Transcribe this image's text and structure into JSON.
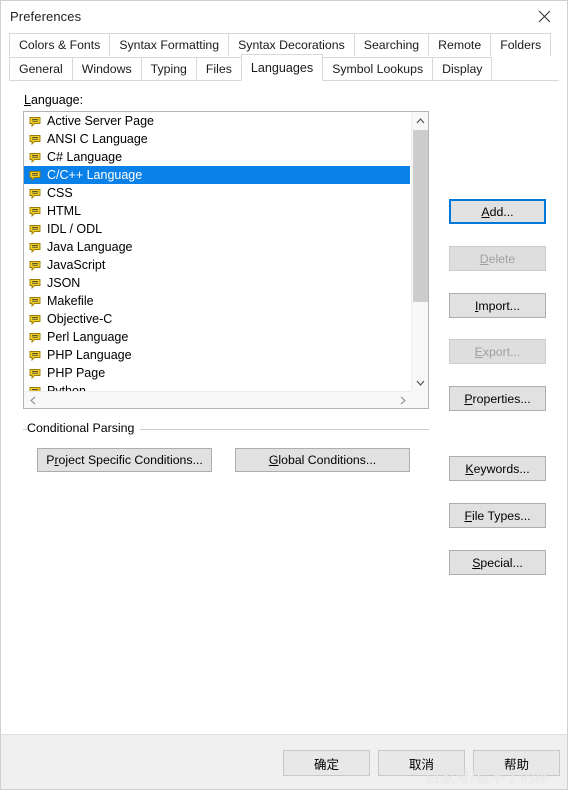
{
  "window": {
    "title": "Preferences",
    "close_icon": "close-icon"
  },
  "tabs": {
    "row1": [
      {
        "label": "Colors & Fonts",
        "selected": false
      },
      {
        "label": "Syntax Formatting",
        "selected": false
      },
      {
        "label": "Syntax Decorations",
        "selected": false
      },
      {
        "label": "Searching",
        "selected": false
      },
      {
        "label": "Remote",
        "selected": false
      },
      {
        "label": "Folders",
        "selected": false
      }
    ],
    "row2": [
      {
        "label": "General",
        "selected": false
      },
      {
        "label": "Windows",
        "selected": false
      },
      {
        "label": "Typing",
        "selected": false
      },
      {
        "label": "Files",
        "selected": false
      },
      {
        "label": "Languages",
        "selected": true
      },
      {
        "label": "Symbol Lookups",
        "selected": false
      },
      {
        "label": "Display",
        "selected": false
      }
    ]
  },
  "language_section": {
    "label_prefix": "L",
    "label_rest": "anguage:",
    "items": [
      {
        "label": "Active Server Page",
        "selected": false
      },
      {
        "label": "ANSI C Language",
        "selected": false
      },
      {
        "label": "C# Language",
        "selected": false
      },
      {
        "label": "C/C++ Language",
        "selected": true
      },
      {
        "label": "CSS",
        "selected": false
      },
      {
        "label": "HTML",
        "selected": false
      },
      {
        "label": "IDL / ODL",
        "selected": false
      },
      {
        "label": "Java Language",
        "selected": false
      },
      {
        "label": "JavaScript",
        "selected": false
      },
      {
        "label": "JSON",
        "selected": false
      },
      {
        "label": "Makefile",
        "selected": false
      },
      {
        "label": "Objective-C",
        "selected": false
      },
      {
        "label": "Perl Language",
        "selected": false
      },
      {
        "label": "PHP Language",
        "selected": false
      },
      {
        "label": "PHP Page",
        "selected": false
      },
      {
        "label": "Python",
        "selected": false
      }
    ],
    "item_icon": "language-file-icon",
    "scrollbar": {
      "up_icon": "chevron-up-icon",
      "down_icon": "chevron-down-icon",
      "left_icon": "chevron-left-icon",
      "right_icon": "chevron-right-icon"
    }
  },
  "side_buttons": [
    {
      "accel": "A",
      "rest": "dd...",
      "disabled": false,
      "default": true
    },
    {
      "accel": "D",
      "rest": "elete",
      "disabled": true,
      "default": false
    },
    {
      "accel": "I",
      "rest": "mport...",
      "disabled": false,
      "default": false
    },
    {
      "accel": "E",
      "rest": "xport...",
      "disabled": true,
      "default": false
    },
    {
      "accel": "P",
      "rest": "roperties...",
      "disabled": false,
      "default": false
    },
    {
      "accel": "K",
      "rest": "eywords...",
      "disabled": false,
      "default": false
    },
    {
      "accel": "F",
      "rest": "ile Types...",
      "disabled": false,
      "default": false
    },
    {
      "accel": "S",
      "rest": "pecial...",
      "disabled": false,
      "default": false
    }
  ],
  "conditional_parsing": {
    "legend": "Conditional Parsing",
    "project_button": {
      "pre": "P",
      "accel": "r",
      "rest": "oject Specific Conditions..."
    },
    "global_button": {
      "pre": "",
      "accel": "G",
      "rest": "lobal Conditions..."
    }
  },
  "bottom_buttons": {
    "ok": "确定",
    "cancel": "取消",
    "help": "帮助"
  },
  "watermark": "百家号/程不了的序",
  "colors": {
    "selection_blue": "#0a81e8",
    "default_button_focus": "#0078d7",
    "dialog_gray": "#f0f0f0",
    "button_face": "#e1e1e1",
    "icon_yellow": "#f2d024"
  }
}
